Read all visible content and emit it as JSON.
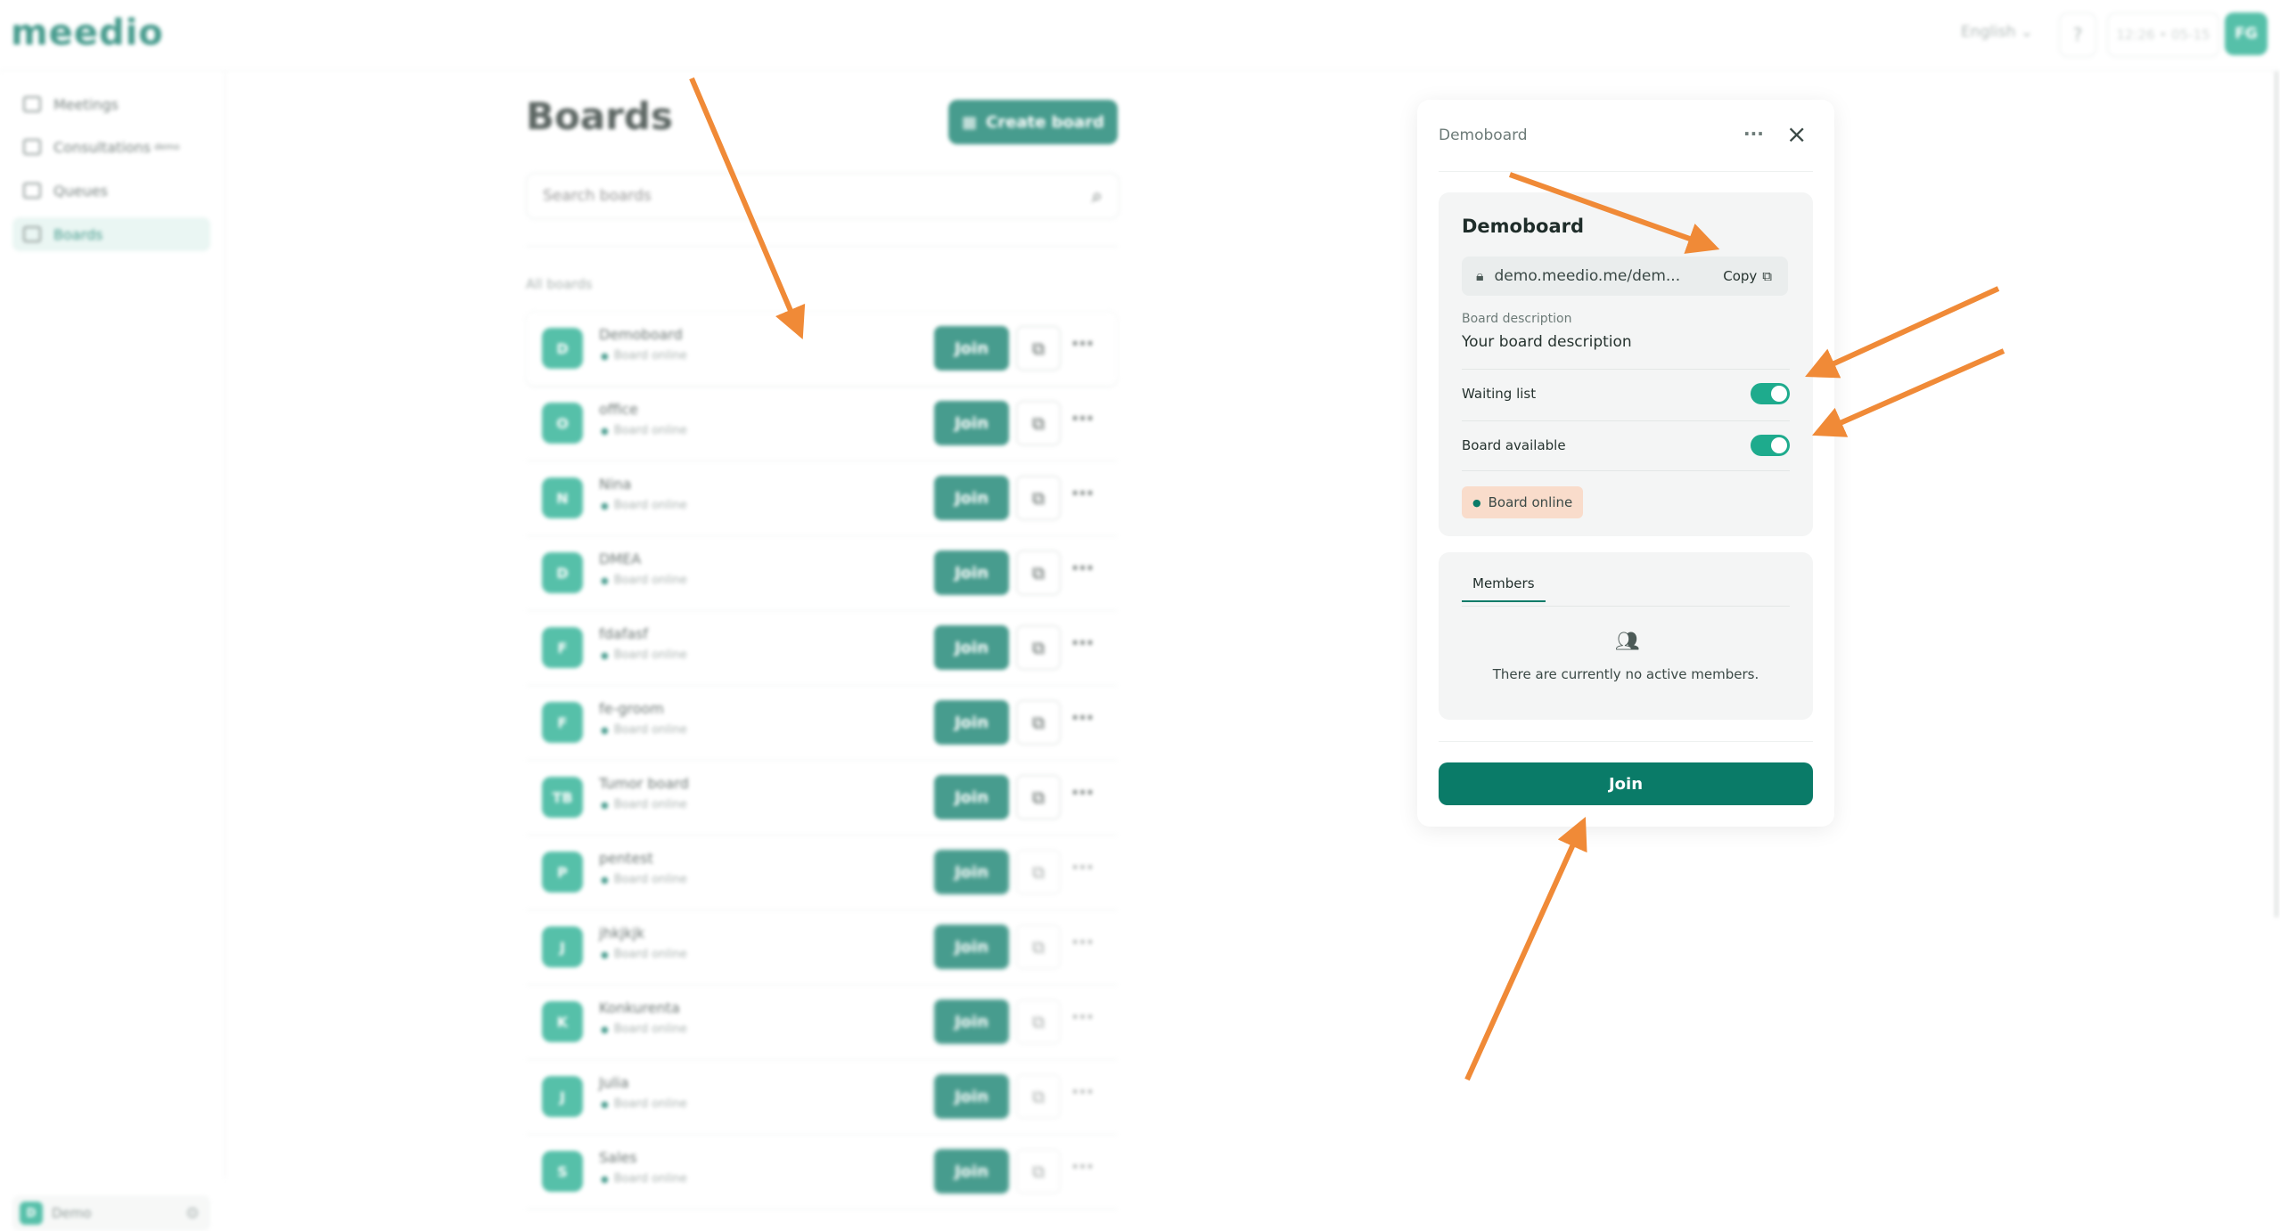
{
  "topbar": {
    "logo": "meedio",
    "language": "English",
    "clock": "12:26 • 05-15",
    "user_initials": "FG"
  },
  "sidebar": {
    "items": [
      {
        "label": "Meetings",
        "badge": ""
      },
      {
        "label": "Consultations",
        "badge": "demo"
      },
      {
        "label": "Queues",
        "badge": ""
      },
      {
        "label": "Boards",
        "badge": ""
      }
    ],
    "account": {
      "initial": "D",
      "name": "Demo"
    }
  },
  "boards_page": {
    "title": "Boards",
    "create_label": "Create board",
    "search_placeholder": "Search boards",
    "section_label": "All boards",
    "join_label": "Join",
    "boards": [
      {
        "initial": "D",
        "name": "Demoboard",
        "status": "Board online"
      },
      {
        "initial": "O",
        "name": "office",
        "status": "Board online"
      },
      {
        "initial": "N",
        "name": "Nina",
        "status": "Board online"
      },
      {
        "initial": "D",
        "name": "DMEA",
        "status": "Board online"
      },
      {
        "initial": "F",
        "name": "fdafasf",
        "status": "Board online"
      },
      {
        "initial": "F",
        "name": "fe-groom",
        "status": "Board online"
      },
      {
        "initial": "TB",
        "name": "Tumor board",
        "status": "Board online"
      },
      {
        "initial": "P",
        "name": "pentest",
        "status": "Board online"
      },
      {
        "initial": "J",
        "name": "jhkjkjk",
        "status": "Board online"
      },
      {
        "initial": "K",
        "name": "Konkurenta",
        "status": "Board online"
      },
      {
        "initial": "J",
        "name": "Julia",
        "status": "Board online"
      },
      {
        "initial": "S",
        "name": "Sales",
        "status": "Board online"
      }
    ]
  },
  "panel": {
    "header": "Demoboard",
    "board_name": "Demoboard",
    "link": "demo.meedio.me/dem...",
    "copy_label": "Copy",
    "description_label": "Board description",
    "description_value": "Your board description",
    "waiting_list_label": "Waiting list",
    "waiting_list_on": true,
    "board_available_label": "Board available",
    "board_available_on": true,
    "status": "Board online",
    "members_tab": "Members",
    "members_empty": "There are currently no active members.",
    "join_label": "Join"
  },
  "colors": {
    "brand": "#0a7b68",
    "accent": "#1eab8d",
    "annotation_arrow": "#f08a37",
    "status_pill": "#f9dccb"
  }
}
